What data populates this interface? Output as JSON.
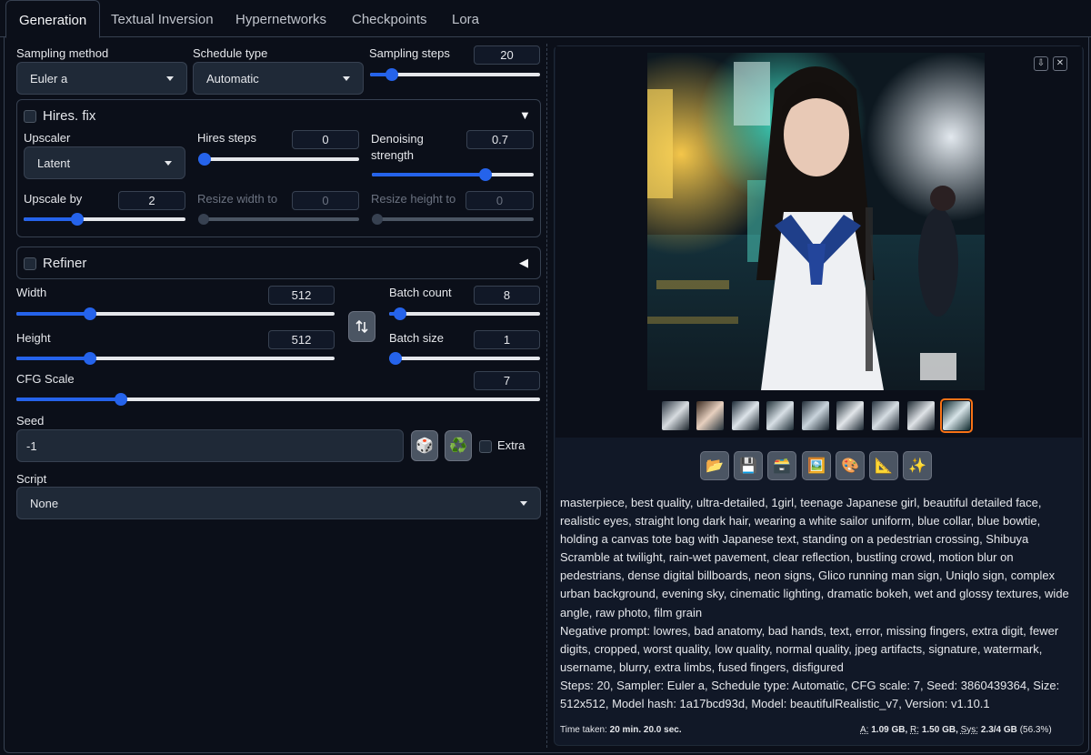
{
  "tabs": [
    "Generation",
    "Textual Inversion",
    "Hypernetworks",
    "Checkpoints",
    "Lora"
  ],
  "sampling": {
    "method_label": "Sampling method",
    "method_value": "Euler a",
    "schedule_label": "Schedule type",
    "schedule_value": "Automatic",
    "steps_label": "Sampling steps",
    "steps_value": "20",
    "steps_fraction": 0.13
  },
  "hires": {
    "title": "Hires. fix",
    "upscaler_label": "Upscaler",
    "upscaler_value": "Latent",
    "steps_label": "Hires steps",
    "steps_value": "0",
    "steps_fraction": 0.0,
    "denoise_label": "Denoising strength",
    "denoise_value": "0.7",
    "denoise_fraction": 0.7,
    "upscale_by_label": "Upscale by",
    "upscale_by_value": "2",
    "upscale_by_fraction": 0.33,
    "resize_w_label": "Resize width to",
    "resize_w_value": "0",
    "resize_h_label": "Resize height to",
    "resize_h_value": "0"
  },
  "refiner": {
    "title": "Refiner"
  },
  "size": {
    "width_label": "Width",
    "width_value": "512",
    "width_fraction": 0.23,
    "height_label": "Height",
    "height_value": "512",
    "height_fraction": 0.23,
    "batch_count_label": "Batch count",
    "batch_count_value": "8",
    "batch_count_fraction": 0.07,
    "batch_size_label": "Batch size",
    "batch_size_value": "1",
    "batch_size_fraction": 0.0,
    "swap_icon": "swap-vertical-arrows"
  },
  "cfg": {
    "label": "CFG Scale",
    "value": "7",
    "fraction": 0.2
  },
  "seed": {
    "label": "Seed",
    "value": "-1",
    "dice_icon": "🎲",
    "recycle_icon": "♻️",
    "extra_label": "Extra"
  },
  "script": {
    "label": "Script",
    "value": "None"
  },
  "gallery": {
    "download_icon": "⇩",
    "close_icon": "✕",
    "tools": [
      "📂",
      "💾",
      "🗃️",
      "🖼️",
      "🎨",
      "📐",
      "✨"
    ]
  },
  "info": {
    "prompt": "masterpiece, best quality, ultra-detailed, 1girl, teenage Japanese girl, beautiful detailed face, realistic eyes, straight long dark hair, wearing a white sailor uniform, blue collar, blue bowtie, holding a canvas tote bag with Japanese text, standing on a pedestrian crossing, Shibuya Scramble at twilight, rain-wet pavement, clear reflection, bustling crowd, motion blur on pedestrians, dense digital billboards, neon signs, Glico running man sign, Uniqlo sign, complex urban background, evening sky, cinematic lighting, dramatic bokeh, wet and glossy textures, wide angle, raw photo, film grain",
    "negative": "Negative prompt: lowres, bad anatomy, bad hands, text, error, missing fingers, extra digit, fewer digits, cropped, worst quality, low quality, normal quality, jpeg artifacts, signature, watermark, username, blurry, extra limbs, fused fingers, disfigured",
    "params": "Steps: 20, Sampler: Euler a, Schedule type: Automatic, CFG scale: 7, Seed: 3860439364, Size: 512x512, Model hash: 1a17bcd93d, Model: beautifulRealistic_v7, Version: v1.10.1"
  },
  "footer": {
    "time_label": "Time taken:",
    "time_value": "20 min. 20.0 sec.",
    "a_label": "A:",
    "a_value": "1.09 GB,",
    "r_label": "R:",
    "r_value": "1.50 GB,",
    "sys_label": "Sys:",
    "sys_value": "2.3/4 GB",
    "sys_pct": "(56.3%)"
  }
}
